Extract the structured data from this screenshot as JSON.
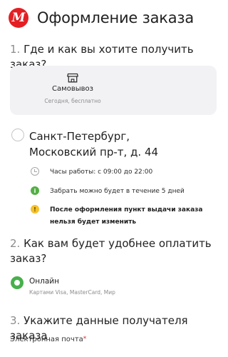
{
  "header": {
    "logo_letter": "М",
    "title": "Оформление заказа"
  },
  "step1": {
    "number": "1.",
    "title": "Где и как вы хотите получить заказ?",
    "option": {
      "icon": "shop-icon",
      "title": "Самовывоз",
      "subtitle": "Сегодня, бесплатно"
    },
    "address": {
      "line1": "Санкт-Петербург,",
      "line2": "Московский пр-т, д. 44"
    },
    "info": [
      {
        "icon": "clock-icon",
        "text": "Часы работы: с 09:00 до 22:00"
      },
      {
        "icon": "check-circle-icon",
        "symbol": "i",
        "text": "Забрать можно будет в течение 5 дней"
      },
      {
        "icon": "warning-icon",
        "symbol": "!",
        "text": "После оформления пункт выдачи заказа нельзя будет изменить"
      }
    ]
  },
  "step2": {
    "number": "2.",
    "title": "Как вам будет удобнее оплатить заказ?",
    "payment": {
      "label": "Онлайн",
      "sublabel": "Картами Visa, MasterCard, Мир",
      "selected": true
    }
  },
  "step3": {
    "number": "3.",
    "title": "Укажите данные получателя заказа",
    "email_label": "Электронная почта",
    "required_mark": "*"
  },
  "colors": {
    "brand": "#e31f24",
    "success": "#47b04b",
    "warning": "#f6c12b",
    "card_bg": "#f2f2f5",
    "muted": "#8c8c8c"
  }
}
